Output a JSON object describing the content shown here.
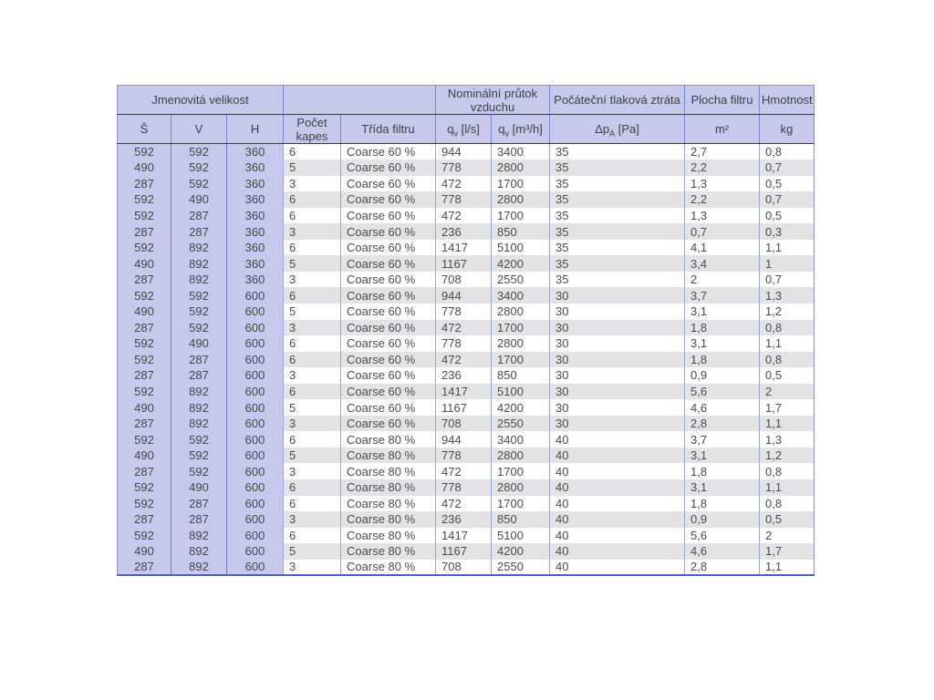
{
  "colors": {
    "header_bg": "#c7c8ec",
    "stripe_bg": "#e3e3e5",
    "border_blue": "#6e7cc4",
    "border_light_blue": "#9aa6d2",
    "outer_border": "#4f61b5",
    "header_rule": "#3c3c40",
    "text": "#4c4c4f"
  },
  "table": {
    "header_groups": [
      {
        "label": "Jmenovitá velikost"
      },
      {
        "label": ""
      },
      {
        "label": "Nominální průtok vzduchu"
      },
      {
        "label": "Počáteční tlaková ztráta"
      },
      {
        "label": "Plocha filtru"
      },
      {
        "label": "Hmotnost"
      }
    ],
    "subheaders": [
      {
        "main": "Š"
      },
      {
        "main": "V"
      },
      {
        "main": "H"
      },
      {
        "main": "Počet kapes"
      },
      {
        "main": "Třída filtru"
      },
      {
        "main": "q",
        "sub": "v",
        "unit": " [l/s]"
      },
      {
        "main": "q",
        "sub": "v",
        "unit": " [m³/h]"
      },
      {
        "main": "Δp",
        "sub": "A",
        "unit": " [Pa]"
      },
      {
        "main": "m²"
      },
      {
        "main": "kg"
      }
    ],
    "column_keys": [
      "sirka",
      "vyska",
      "hloubka",
      "pocet-kapes",
      "trida-filtru",
      "q-ls",
      "q-m3h",
      "dp-pa",
      "plocha-m2",
      "hmotnost-kg"
    ],
    "rows": [
      [
        "592",
        "592",
        "360",
        "6",
        "Coarse 60 %",
        "944",
        "3400",
        "35",
        "2,7",
        "0,8"
      ],
      [
        "490",
        "592",
        "360",
        "5",
        "Coarse 60 %",
        "778",
        "2800",
        "35",
        "2,2",
        "0,7"
      ],
      [
        "287",
        "592",
        "360",
        "3",
        "Coarse 60 %",
        "472",
        "1700",
        "35",
        "1,3",
        "0,5"
      ],
      [
        "592",
        "490",
        "360",
        "6",
        "Coarse 60 %",
        "778",
        "2800",
        "35",
        "2,2",
        "0,7"
      ],
      [
        "592",
        "287",
        "360",
        "6",
        "Coarse 60 %",
        "472",
        "1700",
        "35",
        "1,3",
        "0,5"
      ],
      [
        "287",
        "287",
        "360",
        "3",
        "Coarse 60 %",
        "236",
        "850",
        "35",
        "0,7",
        "0,3"
      ],
      [
        "592",
        "892",
        "360",
        "6",
        "Coarse 60 %",
        "1417",
        "5100",
        "35",
        "4,1",
        "1,1"
      ],
      [
        "490",
        "892",
        "360",
        "5",
        "Coarse 60 %",
        "1167",
        "4200",
        "35",
        "3,4",
        "1"
      ],
      [
        "287",
        "892",
        "360",
        "3",
        "Coarse 60 %",
        "708",
        "2550",
        "35",
        "2",
        "0,7"
      ],
      [
        "592",
        "592",
        "600",
        "6",
        "Coarse 60 %",
        "944",
        "3400",
        "30",
        "3,7",
        "1,3"
      ],
      [
        "490",
        "592",
        "600",
        "5",
        "Coarse 60 %",
        "778",
        "2800",
        "30",
        "3,1",
        "1,2"
      ],
      [
        "287",
        "592",
        "600",
        "3",
        "Coarse 60 %",
        "472",
        "1700",
        "30",
        "1,8",
        "0,8"
      ],
      [
        "592",
        "490",
        "600",
        "6",
        "Coarse 60 %",
        "778",
        "2800",
        "30",
        "3,1",
        "1,1"
      ],
      [
        "592",
        "287",
        "600",
        "6",
        "Coarse 60 %",
        "472",
        "1700",
        "30",
        "1,8",
        "0,8"
      ],
      [
        "287",
        "287",
        "600",
        "3",
        "Coarse 60 %",
        "236",
        "850",
        "30",
        "0,9",
        "0,5"
      ],
      [
        "592",
        "892",
        "600",
        "6",
        "Coarse 60 %",
        "1417",
        "5100",
        "30",
        "5,6",
        "2"
      ],
      [
        "490",
        "892",
        "600",
        "5",
        "Coarse 60 %",
        "1167",
        "4200",
        "30",
        "4,6",
        "1,7"
      ],
      [
        "287",
        "892",
        "600",
        "3",
        "Coarse 60 %",
        "708",
        "2550",
        "30",
        "2,8",
        "1,1"
      ],
      [
        "592",
        "592",
        "600",
        "6",
        "Coarse 80 %",
        "944",
        "3400",
        "40",
        "3,7",
        "1,3"
      ],
      [
        "490",
        "592",
        "600",
        "5",
        "Coarse 80 %",
        "778",
        "2800",
        "40",
        "3,1",
        "1,2"
      ],
      [
        "287",
        "592",
        "600",
        "3",
        "Coarse 80 %",
        "472",
        "1700",
        "40",
        "1,8",
        "0,8"
      ],
      [
        "592",
        "490",
        "600",
        "6",
        "Coarse 80 %",
        "778",
        "2800",
        "40",
        "3,1",
        "1,1"
      ],
      [
        "592",
        "287",
        "600",
        "6",
        "Coarse 80 %",
        "472",
        "1700",
        "40",
        "1,8",
        "0,8"
      ],
      [
        "287",
        "287",
        "600",
        "3",
        "Coarse 80 %",
        "236",
        "850",
        "40",
        "0,9",
        "0,5"
      ],
      [
        "592",
        "892",
        "600",
        "6",
        "Coarse 80 %",
        "1417",
        "5100",
        "40",
        "5,6",
        "2"
      ],
      [
        "490",
        "892",
        "600",
        "5",
        "Coarse 80 %",
        "1167",
        "4200",
        "40",
        "4,6",
        "1,7"
      ],
      [
        "287",
        "892",
        "600",
        "3",
        "Coarse 80 %",
        "708",
        "2550",
        "40",
        "2,8",
        "1,1"
      ]
    ]
  },
  "chart_data": {
    "type": "table",
    "title": "",
    "columns": [
      "Š",
      "V",
      "H",
      "Počet kapes",
      "Třída filtru",
      "qv [l/s]",
      "qv [m³/h]",
      "ΔpA [Pa]",
      "m²",
      "kg"
    ]
  }
}
